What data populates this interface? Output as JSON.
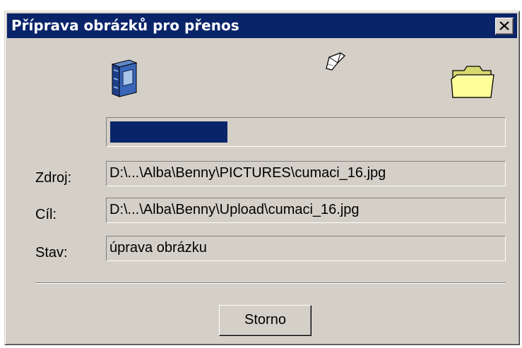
{
  "window": {
    "title": "Příprava obrázků pro přenos"
  },
  "icons": {
    "source": "book-icon",
    "transfer": "flying-paper-icon",
    "destination": "folder-icon",
    "close": "close-icon"
  },
  "progress": {
    "fraction": 0.3
  },
  "fields": {
    "source": {
      "label": "Zdroj:",
      "value": "D:\\...\\Alba\\Benny\\PICTURES\\cumaci_16.jpg"
    },
    "target": {
      "label": "Cíl:",
      "value": "D:\\...\\Alba\\Benny\\Upload\\cumaci_16.jpg"
    },
    "status": {
      "label": "Stav:",
      "value": "úprava obrázku"
    }
  },
  "buttons": {
    "cancel": "Storno"
  },
  "colors": {
    "title_bar": "#0a246a",
    "progress": "#0a246a",
    "face": "#d4d0c8"
  }
}
